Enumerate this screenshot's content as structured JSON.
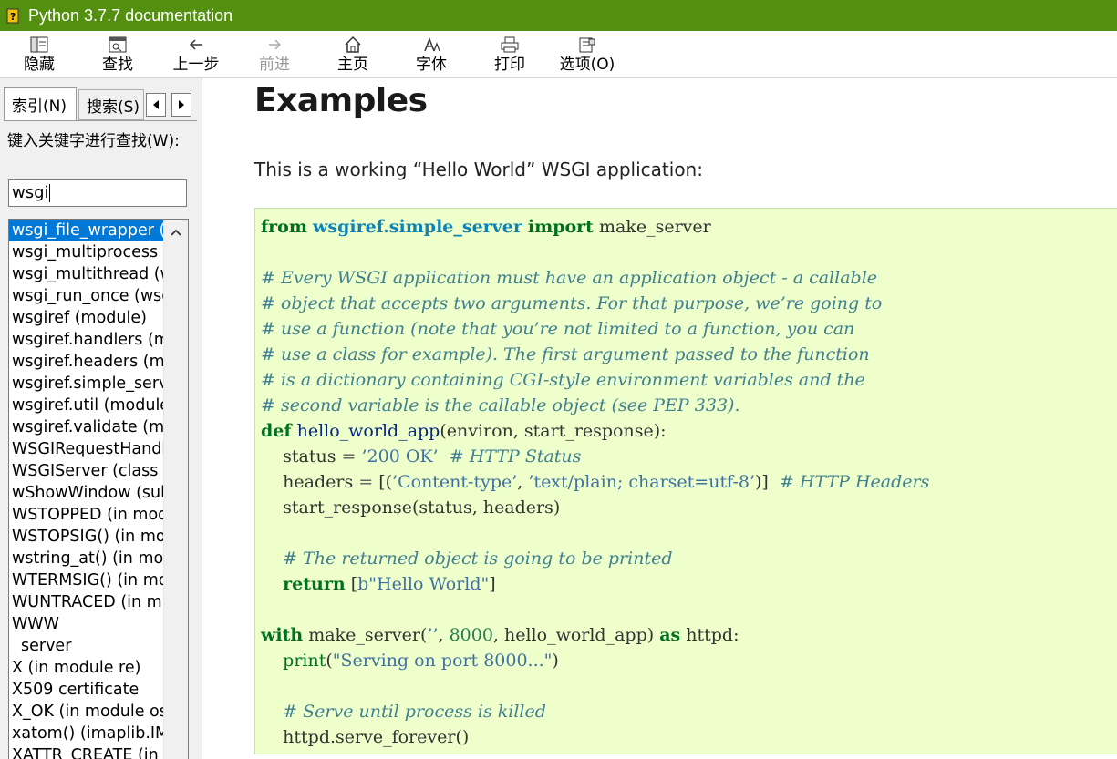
{
  "window": {
    "title": "Python 3.7.7 documentation"
  },
  "toolbar": {
    "buttons": [
      {
        "id": "hide",
        "label": "隐藏",
        "icon": "hide-icon",
        "enabled": true
      },
      {
        "id": "find",
        "label": "查找",
        "icon": "find-icon",
        "enabled": true
      },
      {
        "id": "back",
        "label": "上一步",
        "icon": "back-arrow-icon",
        "enabled": true
      },
      {
        "id": "forward",
        "label": "前进",
        "icon": "forward-arrow-icon",
        "enabled": false
      },
      {
        "id": "home",
        "label": "主页",
        "icon": "home-icon",
        "enabled": true
      },
      {
        "id": "font",
        "label": "字体",
        "icon": "font-icon",
        "enabled": true
      },
      {
        "id": "print",
        "label": "打印",
        "icon": "printer-icon",
        "enabled": true
      },
      {
        "id": "options",
        "label": "选项(O)",
        "icon": "options-icon",
        "enabled": true
      }
    ]
  },
  "sidebar": {
    "tabs": [
      {
        "label": "索引(N)",
        "active": true
      },
      {
        "label": "搜索(S)",
        "active": false
      }
    ],
    "keyword_label": "键入关键字进行查找(W):",
    "keyword_value": "wsgi",
    "index_items": [
      {
        "text": "wsgi_file_wrapper (",
        "selected": true
      },
      {
        "text": "wsgi_multiprocess ("
      },
      {
        "text": "wsgi_multithread (w"
      },
      {
        "text": "wsgi_run_once (wsg"
      },
      {
        "text": "wsgiref (module)"
      },
      {
        "text": "wsgiref.handlers (m"
      },
      {
        "text": "wsgiref.headers (mo"
      },
      {
        "text": "wsgiref.simple_serv"
      },
      {
        "text": "wsgiref.util (module"
      },
      {
        "text": "wsgiref.validate (mo"
      },
      {
        "text": "WSGIRequestHandl"
      },
      {
        "text": "WSGIServer (class in"
      },
      {
        "text": "wShowWindow (sub"
      },
      {
        "text": "WSTOPPED (in mod"
      },
      {
        "text": "WSTOPSIG() (in mo"
      },
      {
        "text": "wstring_at() (in mod"
      },
      {
        "text": "WTERMSIG() (in mo"
      },
      {
        "text": "WUNTRACED (in m"
      },
      {
        "text": "WWW"
      },
      {
        "text": "server",
        "sub": true
      },
      {
        "text": "X (in module re)"
      },
      {
        "text": "X509 certificate"
      },
      {
        "text": "X_OK (in module os"
      },
      {
        "text": "xatom() (imaplib.IM"
      },
      {
        "text": "XATTR_CREATE (in"
      }
    ]
  },
  "content": {
    "heading": "Examples",
    "intro": "This is a working “Hello World” WSGI application:",
    "code_lines": [
      [
        [
          "k",
          "from"
        ],
        [
          "t",
          " "
        ],
        [
          "nn",
          "wsgiref.simple_server"
        ],
        [
          "t",
          " "
        ],
        [
          "k",
          "import"
        ],
        [
          "t",
          " make_server"
        ]
      ],
      [],
      [
        [
          "c",
          "# Every WSGI application must have an application object - a callable"
        ]
      ],
      [
        [
          "c",
          "# object that accepts two arguments. For that purpose, we’re going to"
        ]
      ],
      [
        [
          "c",
          "# use a function (note that you’re not limited to a function, you can"
        ]
      ],
      [
        [
          "c",
          "# use a class for example). The first argument passed to the function"
        ]
      ],
      [
        [
          "c",
          "# is a dictionary containing CGI-style environment variables and the"
        ]
      ],
      [
        [
          "c",
          "# second variable is the callable object (see PEP 333)."
        ]
      ],
      [
        [
          "k",
          "def"
        ],
        [
          "t",
          " "
        ],
        [
          "nf",
          "hello_world_app"
        ],
        [
          "t",
          "(environ, start_response):"
        ]
      ],
      [
        [
          "t",
          "    status "
        ],
        [
          "o",
          "="
        ],
        [
          "t",
          " "
        ],
        [
          "s",
          "’200 OK’"
        ],
        [
          "t",
          "  "
        ],
        [
          "c",
          "# HTTP Status"
        ]
      ],
      [
        [
          "t",
          "    headers "
        ],
        [
          "o",
          "="
        ],
        [
          "t",
          " [("
        ],
        [
          "s",
          "’Content-type’"
        ],
        [
          "t",
          ", "
        ],
        [
          "s",
          "’text/plain; charset=utf-8’"
        ],
        [
          "t",
          ")]  "
        ],
        [
          "c",
          "# HTTP Headers"
        ]
      ],
      [
        [
          "t",
          "    start_response(status, headers)"
        ]
      ],
      [],
      [
        [
          "t",
          "    "
        ],
        [
          "c",
          "# The returned object is going to be printed"
        ]
      ],
      [
        [
          "t",
          "    "
        ],
        [
          "k",
          "return"
        ],
        [
          "t",
          " ["
        ],
        [
          "s",
          "b\"Hello World\""
        ],
        [
          "t",
          "]"
        ]
      ],
      [],
      [
        [
          "k",
          "with"
        ],
        [
          "t",
          " make_server("
        ],
        [
          "s",
          "’’"
        ],
        [
          "t",
          ", "
        ],
        [
          "m",
          "8000"
        ],
        [
          "t",
          ", hello_world_app) "
        ],
        [
          "k",
          "as"
        ],
        [
          "t",
          " httpd:"
        ]
      ],
      [
        [
          "t",
          "    "
        ],
        [
          "nb",
          "print"
        ],
        [
          "t",
          "("
        ],
        [
          "s",
          "\"Serving on port 8000...\""
        ],
        [
          "t",
          ")"
        ]
      ],
      [],
      [
        [
          "t",
          "    "
        ],
        [
          "c",
          "# Serve until process is killed"
        ]
      ],
      [
        [
          "t",
          "    httpd.serve_forever()"
        ]
      ]
    ]
  },
  "colors": {
    "titlebar": "#53900f",
    "selection": "#0078d7",
    "code_background": "#eeffcc"
  }
}
